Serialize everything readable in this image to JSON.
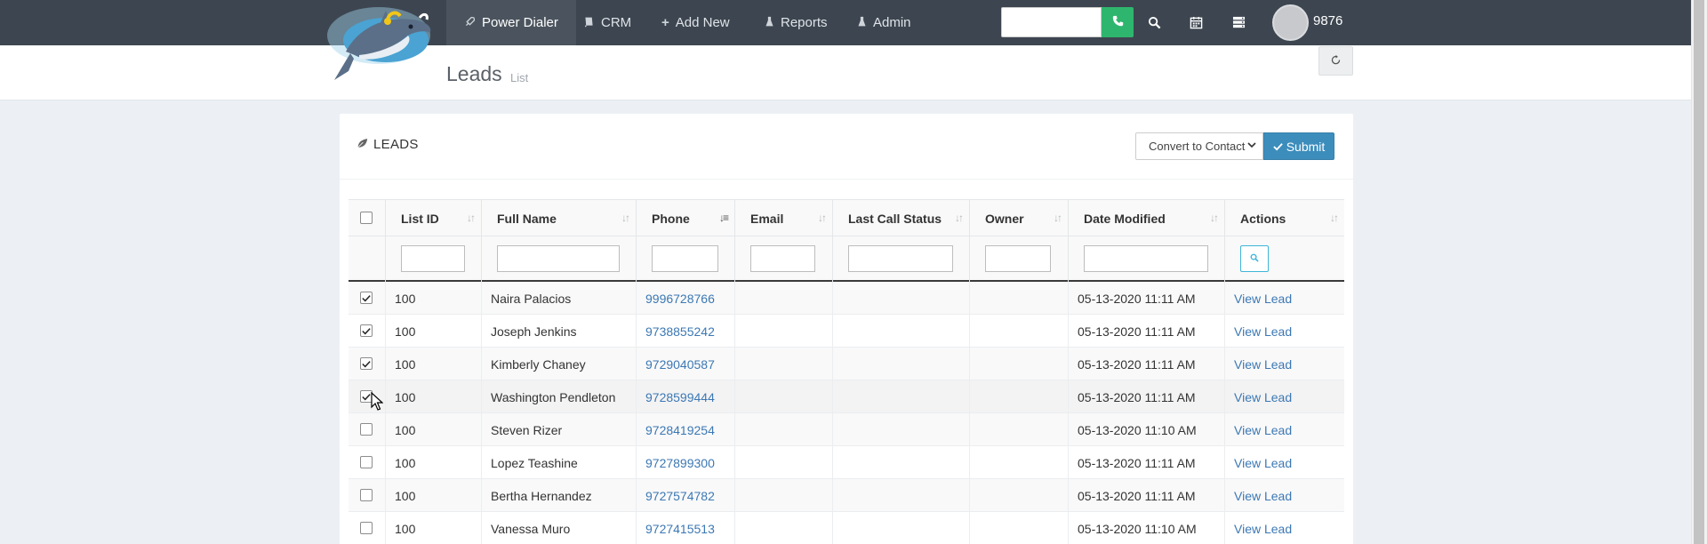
{
  "nav": {
    "items": [
      {
        "label": "Power Dialer",
        "icon": "rocket-icon"
      },
      {
        "label": "CRM",
        "icon": "book-icon"
      },
      {
        "label": "Add New",
        "icon": "plus-icon"
      },
      {
        "label": "Reports",
        "icon": "flask-icon"
      },
      {
        "label": "Admin",
        "icon": "flask-icon"
      }
    ],
    "search_value": "",
    "user_id": "9876"
  },
  "page": {
    "title": "Leads",
    "subtitle": "List"
  },
  "panel": {
    "title": "LEADS",
    "action_select": "Convert to Contact",
    "submit_label": "Submit"
  },
  "table": {
    "columns": [
      "List ID",
      "Full Name",
      "Phone",
      "Email",
      "Last Call Status",
      "Owner",
      "Date Modified",
      "Actions"
    ],
    "rows": [
      {
        "checked": true,
        "list_id": "100",
        "name": "Naira Palacios",
        "phone": "9996728766",
        "email": "",
        "status": "",
        "owner": "",
        "date": "05-13-2020 11:11 AM",
        "action": "View Lead"
      },
      {
        "checked": true,
        "list_id": "100",
        "name": "Joseph Jenkins",
        "phone": "9738855242",
        "email": "",
        "status": "",
        "owner": "",
        "date": "05-13-2020 11:11 AM",
        "action": "View Lead"
      },
      {
        "checked": true,
        "list_id": "100",
        "name": "Kimberly Chaney",
        "phone": "9729040587",
        "email": "",
        "status": "",
        "owner": "",
        "date": "05-13-2020 11:11 AM",
        "action": "View Lead"
      },
      {
        "checked": true,
        "list_id": "100",
        "name": "Washington Pendleton",
        "phone": "9728599444",
        "email": "",
        "status": "",
        "owner": "",
        "date": "05-13-2020 11:11 AM",
        "action": "View Lead"
      },
      {
        "checked": false,
        "list_id": "100",
        "name": "Steven Rizer",
        "phone": "9728419254",
        "email": "",
        "status": "",
        "owner": "",
        "date": "05-13-2020 11:10 AM",
        "action": "View Lead"
      },
      {
        "checked": false,
        "list_id": "100",
        "name": "Lopez Teashine",
        "phone": "9727899300",
        "email": "",
        "status": "",
        "owner": "",
        "date": "05-13-2020 11:11 AM",
        "action": "View Lead"
      },
      {
        "checked": false,
        "list_id": "100",
        "name": "Bertha Hernandez",
        "phone": "9727574782",
        "email": "",
        "status": "",
        "owner": "",
        "date": "05-13-2020 11:11 AM",
        "action": "View Lead"
      },
      {
        "checked": false,
        "list_id": "100",
        "name": "Vanessa Muro",
        "phone": "9727415513",
        "email": "",
        "status": "",
        "owner": "",
        "date": "05-13-2020 11:10 AM",
        "action": "View Lead"
      }
    ]
  },
  "colors": {
    "nav_bg": "#3d4650",
    "call_green": "#2fb66e",
    "submit_blue": "#3c8dbc",
    "link_blue": "#3c78b4"
  }
}
